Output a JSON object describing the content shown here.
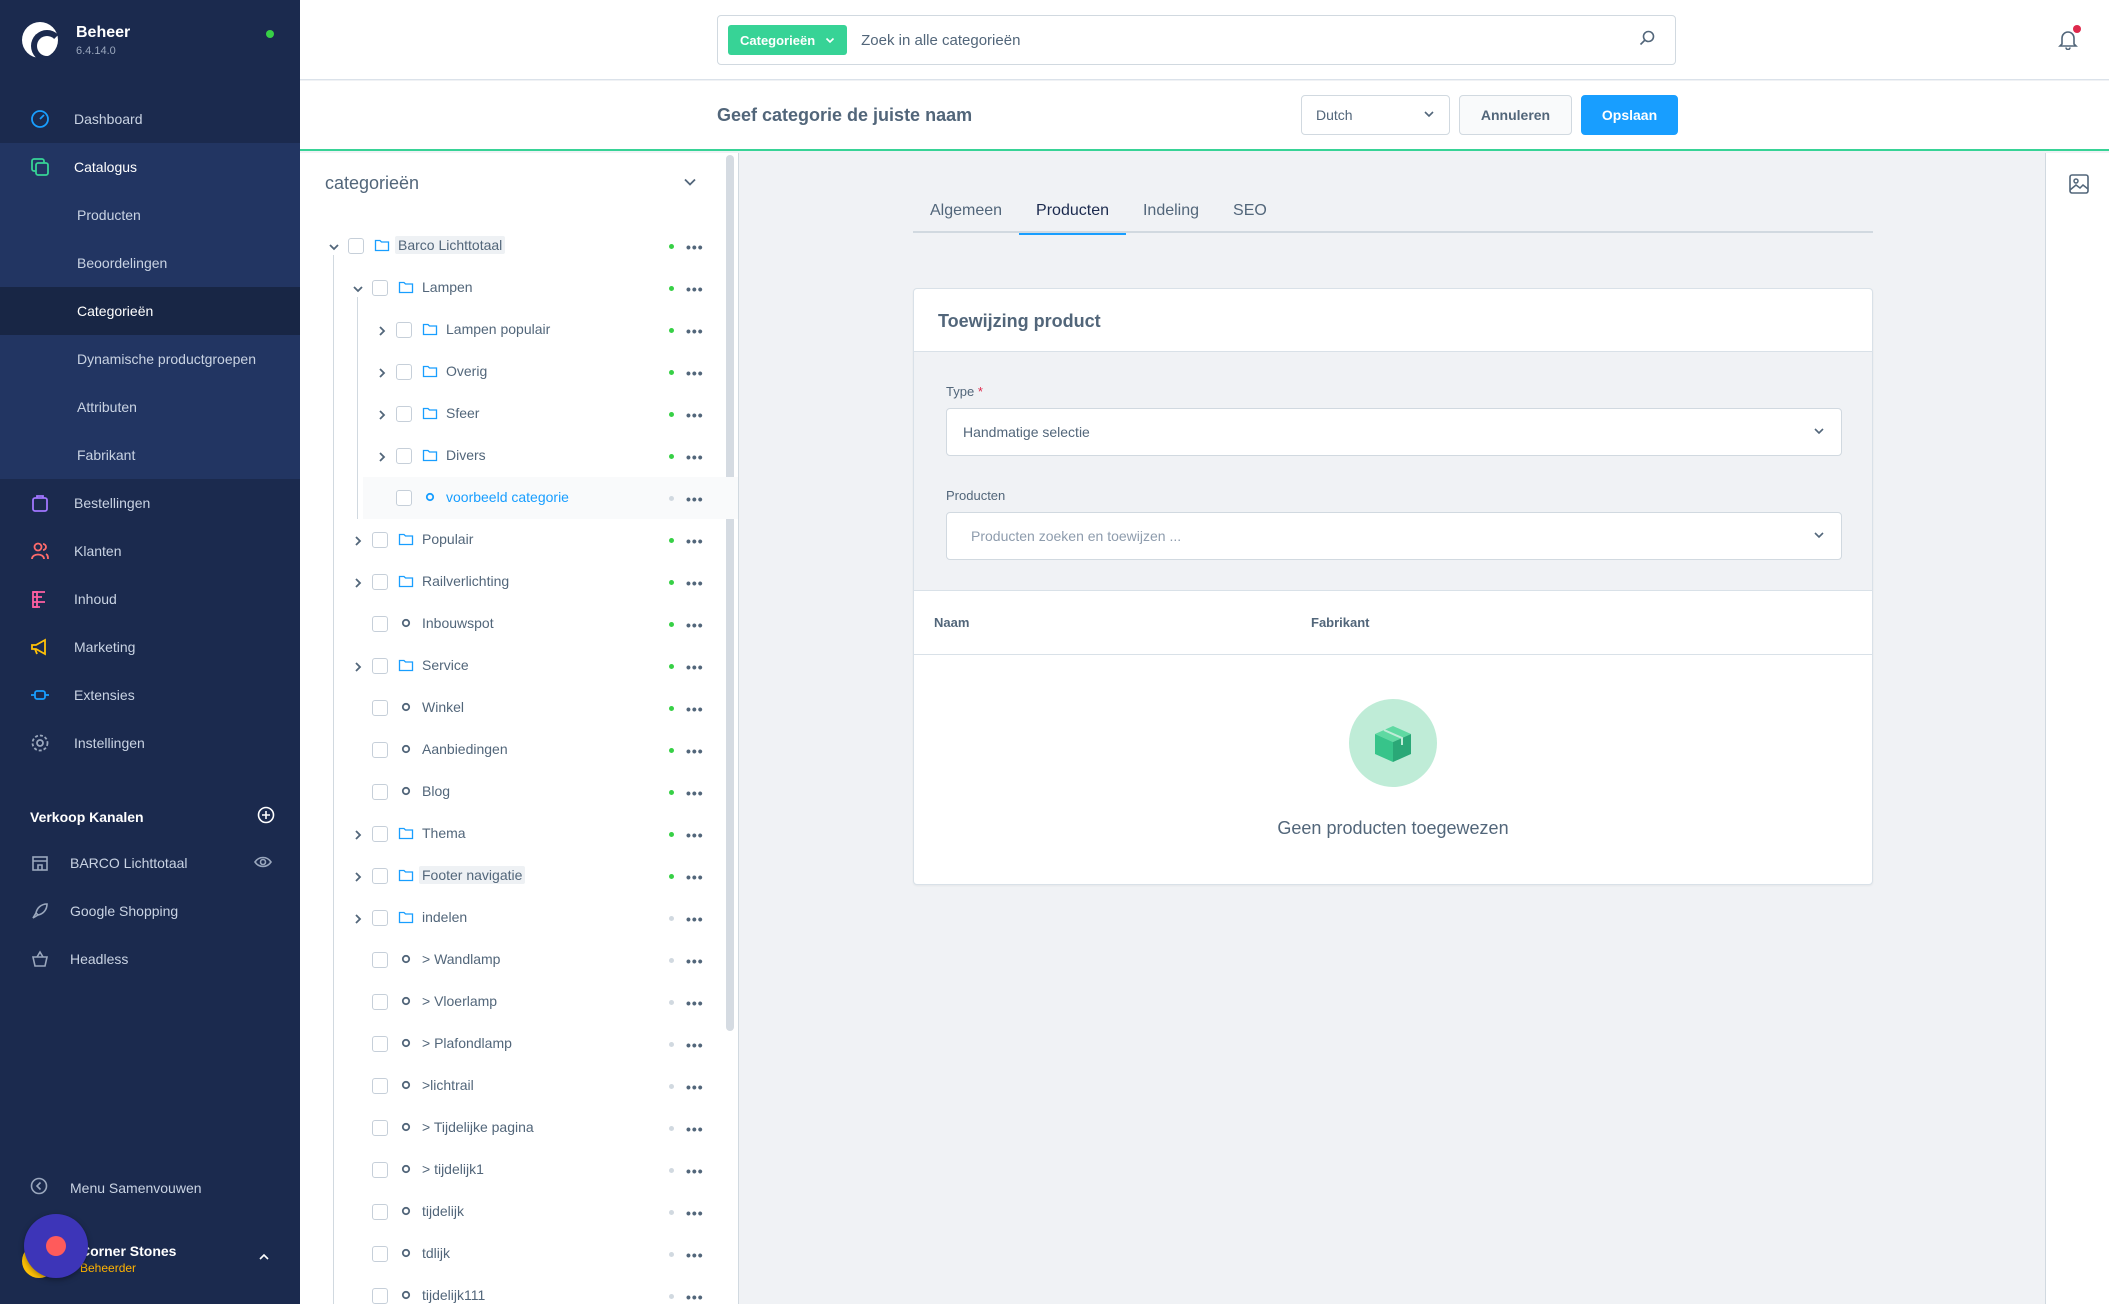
{
  "brand": {
    "title": "Beheer",
    "version": "6.4.14.0"
  },
  "nav": {
    "dashboard": "Dashboard",
    "catalogus": "Catalogus",
    "sub": [
      "Producten",
      "Beoordelingen",
      "Categorieën",
      "Dynamische productgroepen",
      "Attributen",
      "Fabrikant"
    ],
    "bestellingen": "Bestellingen",
    "klanten": "Klanten",
    "inhoud": "Inhoud",
    "marketing": "Marketing",
    "extensies": "Extensies",
    "instellingen": "Instellingen"
  },
  "sales_channels": {
    "header": "Verkoop Kanalen",
    "items": [
      "BARCO Lichttotaal",
      "Google Shopping",
      "Headless"
    ]
  },
  "collapse_label": "Menu Samenvouwen",
  "user": {
    "name": "Corner Stones",
    "role": "Beheerder"
  },
  "search": {
    "type_label": "Categorieën",
    "placeholder": "Zoek in alle categorieën"
  },
  "smartbar": {
    "title": "Geef categorie de juiste naam",
    "language": "Dutch",
    "cancel": "Annuleren",
    "save": "Opslaan"
  },
  "tree": {
    "title": "categorieën",
    "items": [
      {
        "label": "Barco Lichttotaal",
        "active": true
      },
      {
        "label": "Lampen",
        "active": true
      },
      {
        "label": "Lampen populair",
        "active": true
      },
      {
        "label": "Overig",
        "active": true
      },
      {
        "label": "Sfeer",
        "active": true
      },
      {
        "label": "Divers",
        "active": true
      },
      {
        "label": "voorbeeld categorie",
        "active": false
      },
      {
        "label": "Populair",
        "active": true
      },
      {
        "label": "Railverlichting",
        "active": true
      },
      {
        "label": "Inbouwspot",
        "active": true
      },
      {
        "label": "Service",
        "active": true
      },
      {
        "label": "Winkel",
        "active": true
      },
      {
        "label": "Aanbiedingen",
        "active": true
      },
      {
        "label": "Blog",
        "active": true
      },
      {
        "label": "Thema",
        "active": true
      },
      {
        "label": "Footer navigatie",
        "active": true
      },
      {
        "label": "indelen",
        "active": false
      },
      {
        "label": "> Wandlamp",
        "active": false
      },
      {
        "label": "> Vloerlamp",
        "active": false
      },
      {
        "label": "> Plafondlamp",
        "active": false
      },
      {
        "label": ">lichtrail",
        "active": false
      },
      {
        "label": "> Tijdelijke pagina",
        "active": false
      },
      {
        "label": "> tijdelijk1",
        "active": false
      },
      {
        "label": "tijdelijk",
        "active": false
      },
      {
        "label": "tdlijk",
        "active": false
      },
      {
        "label": "tijdelijk111",
        "active": false
      }
    ]
  },
  "tabs": [
    "Algemeen",
    "Producten",
    "Indeling",
    "SEO"
  ],
  "active_tab": "Producten",
  "card": {
    "title": "Toewijzing product",
    "type_label": "Type",
    "type_required": "*",
    "type_value": "Handmatige selectie",
    "products_label": "Producten",
    "products_placeholder": "Producten zoeken en toewijzen ...",
    "col_name": "Naam",
    "col_manufacturer": "Fabrikant",
    "empty": "Geen producten toegewezen"
  },
  "colors": {
    "sidebar": "#1b2a4e",
    "accent_green": "#37d396",
    "primary": "#189eff",
    "status_active": "#37d046"
  }
}
